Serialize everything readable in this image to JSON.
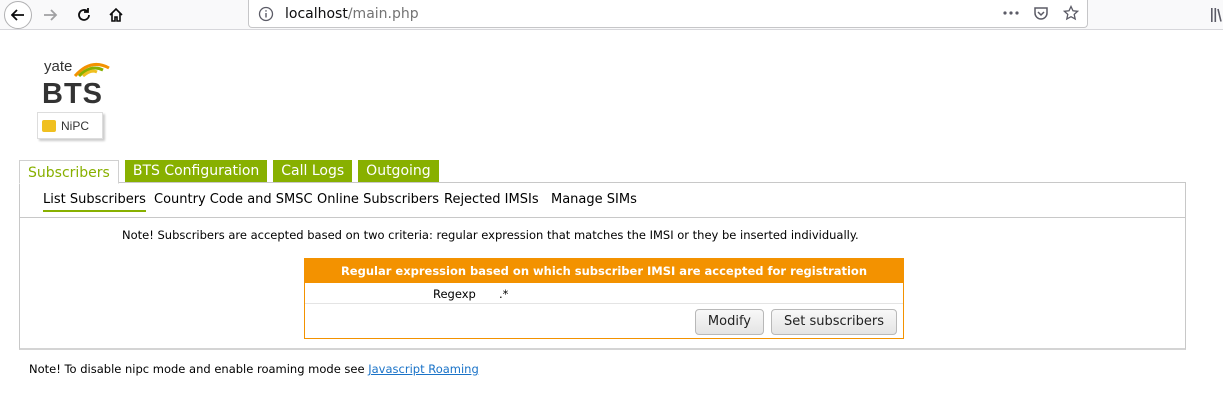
{
  "browser": {
    "url_host": "localhost",
    "url_path": "/main.php",
    "icons": {
      "back": "back-arrow-icon",
      "forward": "forward-arrow-icon",
      "reload": "reload-icon",
      "home": "home-icon",
      "info": "info-icon",
      "more": "more-icon",
      "pocket": "pocket-icon",
      "bookmark": "bookmark-star-icon",
      "library": "library-icon"
    }
  },
  "logo": {
    "line1": "yate",
    "line2": "BTS",
    "badge": "NiPC"
  },
  "main_tabs": [
    {
      "label": "Subscribers",
      "active": true
    },
    {
      "label": "BTS Configuration",
      "active": false
    },
    {
      "label": "Call Logs",
      "active": false
    },
    {
      "label": "Outgoing",
      "active": false
    }
  ],
  "sub_tabs": [
    {
      "label": "List Subscribers",
      "active": true
    },
    {
      "label": "Country Code and SMSC",
      "active": false
    },
    {
      "label": "Online Subscribers",
      "active": false
    },
    {
      "label": "Rejected IMSIs",
      "active": false
    },
    {
      "label": "Manage SIMs",
      "active": false
    }
  ],
  "note_criteria": "Note! Subscribers are accepted based on two criteria: regular expression that matches the IMSI or they be inserted individually.",
  "regex_panel": {
    "title": "Regular expression based on which subscriber IMSI are accepted for registration",
    "label": "Regexp",
    "value": ".*",
    "modify_label": "Modify",
    "set_label": "Set subscribers"
  },
  "footer_note": {
    "text": "Note! To disable nipc mode and enable roaming mode see ",
    "link": "Javascript Roaming"
  },
  "colors": {
    "accent_green": "#88b000",
    "accent_orange": "#f39200",
    "link_blue": "#1a73c8"
  }
}
